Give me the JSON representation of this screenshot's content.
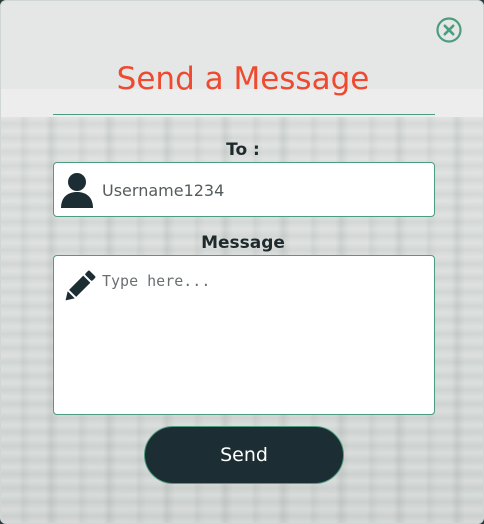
{
  "dialog": {
    "title": "Send a Message",
    "close_icon": "close-circle-icon"
  },
  "to_field": {
    "label": "To :",
    "icon": "user-icon",
    "value": "",
    "placeholder": "Username1234"
  },
  "message_field": {
    "label": "Message",
    "icon": "pencil-icon",
    "value": "",
    "placeholder": "Type here..."
  },
  "send_button": {
    "label": "Send"
  },
  "colors": {
    "title": "#ef4a2f",
    "accent": "#4c9d7f",
    "button_bg": "#1c2e33",
    "icon_dark": "#1c2e33"
  }
}
